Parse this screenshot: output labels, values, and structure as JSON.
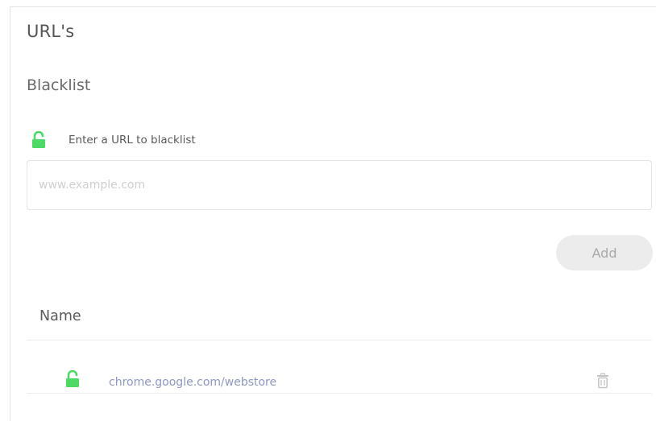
{
  "page": {
    "title": "URL's",
    "section_title": "Blacklist"
  },
  "form": {
    "label": "Enter a URL to blacklist",
    "label_icon": "unlocked-padlock-icon",
    "input_value": "",
    "input_placeholder": "www.example.com",
    "add_label": "Add"
  },
  "table": {
    "columns": [
      "Name"
    ],
    "rows": [
      {
        "icon": "unlocked-padlock-icon",
        "url": "chrome.google.com/webstore",
        "action_icon": "trash-icon"
      }
    ]
  },
  "colors": {
    "lock_green": "#4cd964",
    "link_text": "#8e97c4",
    "button_bg": "#ececec",
    "button_text": "#a9a9a9",
    "trash_gray": "#c4c4c4"
  }
}
